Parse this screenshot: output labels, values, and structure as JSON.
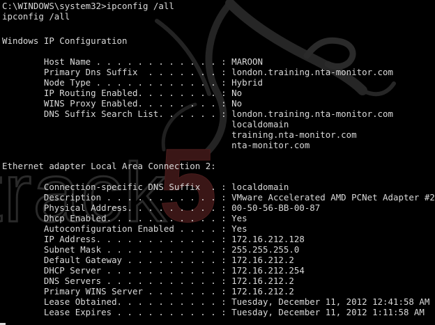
{
  "terminal": {
    "command_echo": "C:\\WINDOWS\\system32>ipconfig /all",
    "command": "ipconfig /all",
    "windows_ip_header": "Windows IP Configuration",
    "host_name": "        Host Name . . . . . . . . . . . . : MAROON",
    "primary_dns_suffix": "        Primary Dns Suffix  . . . . . . . : london.training.nta-monitor.com",
    "node_type": "        Node Type . . . . . . . . . . . . : Hybrid",
    "ip_routing": "        IP Routing Enabled. . . . . . . . : No",
    "wins_proxy": "        WINS Proxy Enabled. . . . . . . . : No",
    "dns_search_list": "        DNS Suffix Search List. . . . . . : london.training.nta-monitor.com",
    "dns_search_2": "                                            localdomain",
    "dns_search_3": "                                            training.nta-monitor.com",
    "dns_search_4": "                                            nta-monitor.com",
    "adapter_header": "Ethernet adapter Local Area Connection 2:",
    "conn_dns_suffix": "        Connection-specific DNS Suffix  . : localdomain",
    "description": "        Description . . . . . . . . . . . : VMware Accelerated AMD PCNet Adapter #2",
    "physical_address": "        Physical Address. . . . . . . . . : 00-50-56-BB-00-87",
    "dhcp_enabled": "        Dhcp Enabled. . . . . . . . . . . : Yes",
    "autoconfig_enabled": "        Autoconfiguration Enabled . . . . : Yes",
    "ip_address": "        IP Address. . . . . . . . . . . . : 172.16.212.128",
    "subnet_mask": "        Subnet Mask . . . . . . . . . . . : 255.255.255.0",
    "default_gateway": "        Default Gateway . . . . . . . . . : 172.16.212.2",
    "dhcp_server": "        DHCP Server . . . . . . . . . . . : 172.16.212.254",
    "dns_servers": "        DNS Servers . . . . . . . . . . . : 172.16.212.2",
    "primary_wins": "        Primary WINS Server . . . . . . . : 172.16.212.2",
    "lease_obtained": "        Lease Obtained. . . . . . . . . . : Tuesday, December 11, 2012 12:41:58 AM",
    "lease_expires": "        Lease Expires . . . . . . . . . . : Tuesday, December 11, 2012 1:11:58 AM"
  },
  "wallpaper": {
    "logo_text": "track",
    "logo_number": "5",
    "logo_color": "#2a2a2a",
    "number_color": "#3a1616",
    "dragon_color": "#262626"
  },
  "colors": {
    "background": "#000000",
    "text": "#dadada"
  }
}
